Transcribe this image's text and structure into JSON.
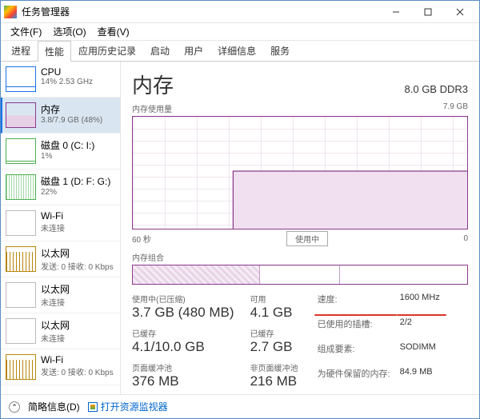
{
  "titlebar": {
    "title": "任务管理器"
  },
  "menu": {
    "file": "文件(F)",
    "options": "选项(O)",
    "view": "查看(V)"
  },
  "tabs": {
    "processes": "进程",
    "performance": "性能",
    "apphistory": "应用历史记录",
    "startup": "启动",
    "users": "用户",
    "details": "详细信息",
    "services": "服务"
  },
  "sidebar": {
    "items": [
      {
        "name": "CPU",
        "sub": "14% 2.53 GHz"
      },
      {
        "name": "内存",
        "sub": "3.8/7.9 GB (48%)"
      },
      {
        "name": "磁盘 0 (C: I:)",
        "sub": "1%"
      },
      {
        "name": "磁盘 1 (D: F: G:)",
        "sub": "22%"
      },
      {
        "name": "Wi-Fi",
        "sub": "未连接"
      },
      {
        "name": "以太网",
        "sub": "发送: 0 接收: 0 Kbps"
      },
      {
        "name": "以太网",
        "sub": "未连接"
      },
      {
        "name": "以太网",
        "sub": "未连接"
      },
      {
        "name": "Wi-Fi",
        "sub": "发送: 0 接收: 0 Kbps"
      }
    ]
  },
  "main": {
    "title": "内存",
    "spec": "8.0 GB DDR3",
    "chart_label": "内存使用量",
    "chart_max": "7.9 GB",
    "xaxis_left": "60 秒",
    "xaxis_right": "0",
    "in_use_tag": "使用中",
    "composition_label": "内存组合"
  },
  "stats": {
    "used_label": "使用中(已压缩)",
    "used_value": "3.7 GB (480 MB)",
    "avail_label": "可用",
    "avail_value": "4.1 GB",
    "committed_label": "已缓存",
    "committed_value": "4.1/10.0 GB",
    "cached_label": "已缓存",
    "cached_value": "2.7 GB",
    "paged_label": "页面缓冲池",
    "paged_value": "376 MB",
    "nonpaged_label": "非页面缓冲池",
    "nonpaged_value": "216 MB",
    "speed_k": "速度:",
    "speed_v": "1600 MHz",
    "slots_k": "已使用的插槽:",
    "slots_v": "2/2",
    "form_k": "组成要素:",
    "form_v": "SODIMM",
    "reserved_k": "为硬件保留的内存:",
    "reserved_v": "84.9 MB"
  },
  "footer": {
    "brief": "简略信息(D)",
    "resmon": "打开资源监视器"
  },
  "chart_data": {
    "type": "area",
    "title": "内存使用量",
    "xlabel": "60 秒 → 0",
    "ylabel": "GB",
    "ylim": [
      0,
      7.9
    ],
    "x": [
      0,
      5,
      10,
      15,
      20,
      25,
      30,
      35,
      40,
      45,
      50,
      55,
      60
    ],
    "values": [
      0,
      0,
      0,
      0,
      0,
      0,
      3.8,
      3.8,
      3.8,
      3.8,
      3.8,
      3.8,
      3.8
    ],
    "note": "Memory usage over last 60 seconds; flat at ~3.8 GB after step at ~t=30s, 0 before (chart not yet filled)"
  }
}
